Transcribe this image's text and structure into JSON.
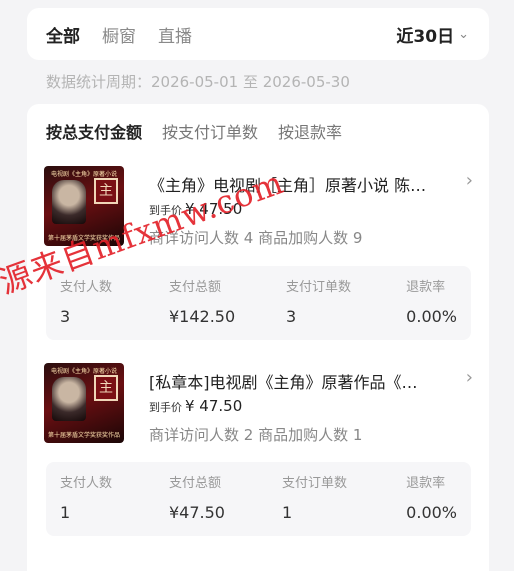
{
  "header": {
    "tabs": [
      "全部",
      "橱窗",
      "直播"
    ],
    "active_tab_index": 0,
    "period_label": "近30日"
  },
  "stat_period": "数据统计周期：2026-05-01 至 2026-05-30",
  "sort_tabs": [
    "按总支付金额",
    "按支付订单数",
    "按退款率"
  ],
  "products": [
    {
      "title": "《主角》电视剧［主角］原著小说 陈…",
      "price_label": "到手价",
      "price": "¥ 47.50",
      "visits": "商详访问人数 4  商品加购人数 9",
      "thumb_top": "电视剧《主角》原著小说",
      "thumb_seal": "主",
      "thumb_bottom": "第十届茅盾文学奖获奖作品",
      "metrics": [
        {
          "label": "支付人数",
          "value": "3"
        },
        {
          "label": "支付总额",
          "value": "¥142.50"
        },
        {
          "label": "支付订单数",
          "value": "3"
        },
        {
          "label": "退款率",
          "value": "0.00%"
        }
      ]
    },
    {
      "title": "[私章本]电视剧《主角》原著作品《…",
      "price_label": "到手价",
      "price": "¥ 47.50",
      "visits": "商详访问人数 2  商品加购人数 1",
      "thumb_top": "电视剧《主角》原著小说",
      "thumb_seal": "主",
      "thumb_bottom": "第十届茅盾文学奖获奖作品",
      "metrics": [
        {
          "label": "支付人数",
          "value": "1"
        },
        {
          "label": "支付总额",
          "value": "¥47.50"
        },
        {
          "label": "支付订单数",
          "value": "1"
        },
        {
          "label": "退款率",
          "value": "0.00%"
        }
      ]
    }
  ],
  "watermark": "源来自mfxmw.com",
  "colors": {
    "watermark": "#e3222a",
    "page_bg": "#f4f4f6"
  }
}
